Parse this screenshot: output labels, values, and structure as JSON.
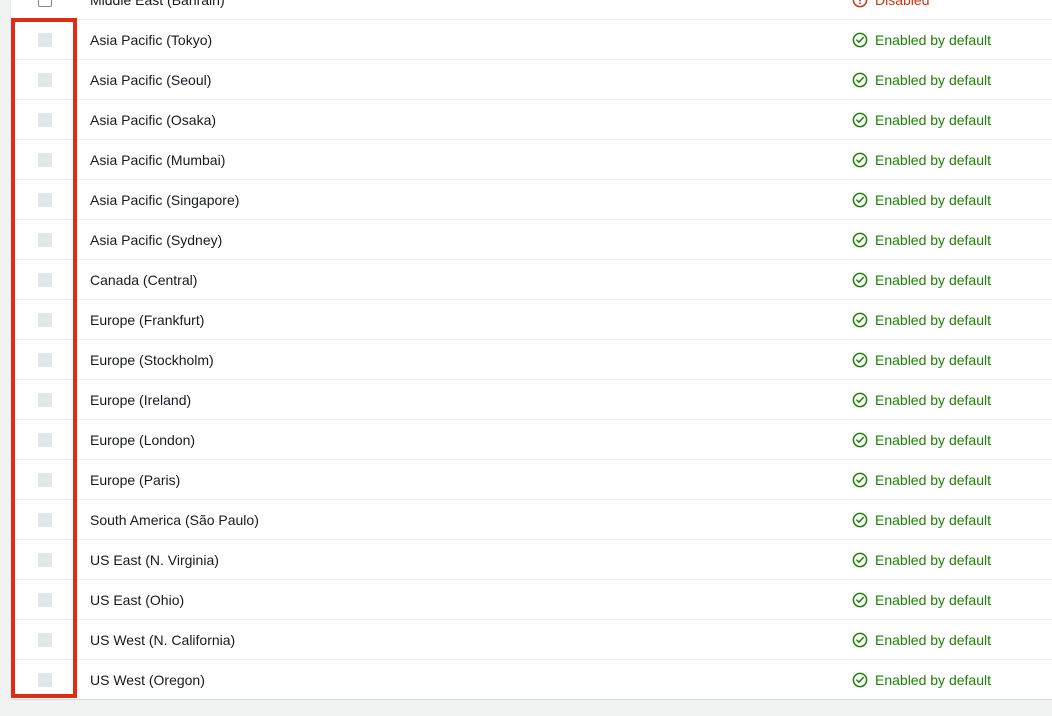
{
  "page": {
    "background_color": "#f1f3f3",
    "panel_background": "#ffffff",
    "row_divider_color": "#e9ebed"
  },
  "annotation": {
    "shape": "rectangle",
    "color": "#e32a12",
    "stroke_width": 4,
    "target": "region-select-checkbox-column"
  },
  "status_colors": {
    "enabled": "#1d8102",
    "disabled": "#d13212"
  },
  "icons": {
    "enabled": "check-circle-icon",
    "disabled": "error-circle-icon",
    "checkbox_enabled": "checkbox-unchecked-icon",
    "checkbox_disabled": "checkbox-disabled-icon"
  },
  "table": {
    "rows": [
      {
        "name": "Middle East (Bahrain)",
        "status": "Disabled",
        "state": "bad",
        "checkbox": "enabled"
      },
      {
        "name": "Asia Pacific (Tokyo)",
        "status": "Enabled by default",
        "state": "ok",
        "checkbox": "disabled"
      },
      {
        "name": "Asia Pacific (Seoul)",
        "status": "Enabled by default",
        "state": "ok",
        "checkbox": "disabled"
      },
      {
        "name": "Asia Pacific (Osaka)",
        "status": "Enabled by default",
        "state": "ok",
        "checkbox": "disabled"
      },
      {
        "name": "Asia Pacific (Mumbai)",
        "status": "Enabled by default",
        "state": "ok",
        "checkbox": "disabled"
      },
      {
        "name": "Asia Pacific (Singapore)",
        "status": "Enabled by default",
        "state": "ok",
        "checkbox": "disabled"
      },
      {
        "name": "Asia Pacific (Sydney)",
        "status": "Enabled by default",
        "state": "ok",
        "checkbox": "disabled"
      },
      {
        "name": "Canada (Central)",
        "status": "Enabled by default",
        "state": "ok",
        "checkbox": "disabled"
      },
      {
        "name": "Europe (Frankfurt)",
        "status": "Enabled by default",
        "state": "ok",
        "checkbox": "disabled"
      },
      {
        "name": "Europe (Stockholm)",
        "status": "Enabled by default",
        "state": "ok",
        "checkbox": "disabled"
      },
      {
        "name": "Europe (Ireland)",
        "status": "Enabled by default",
        "state": "ok",
        "checkbox": "disabled"
      },
      {
        "name": "Europe (London)",
        "status": "Enabled by default",
        "state": "ok",
        "checkbox": "disabled"
      },
      {
        "name": "Europe (Paris)",
        "status": "Enabled by default",
        "state": "ok",
        "checkbox": "disabled"
      },
      {
        "name": "South America (São Paulo)",
        "status": "Enabled by default",
        "state": "ok",
        "checkbox": "disabled"
      },
      {
        "name": "US East (N. Virginia)",
        "status": "Enabled by default",
        "state": "ok",
        "checkbox": "disabled"
      },
      {
        "name": "US East (Ohio)",
        "status": "Enabled by default",
        "state": "ok",
        "checkbox": "disabled"
      },
      {
        "name": "US West (N. California)",
        "status": "Enabled by default",
        "state": "ok",
        "checkbox": "disabled"
      },
      {
        "name": "US West (Oregon)",
        "status": "Enabled by default",
        "state": "ok",
        "checkbox": "disabled"
      }
    ]
  }
}
